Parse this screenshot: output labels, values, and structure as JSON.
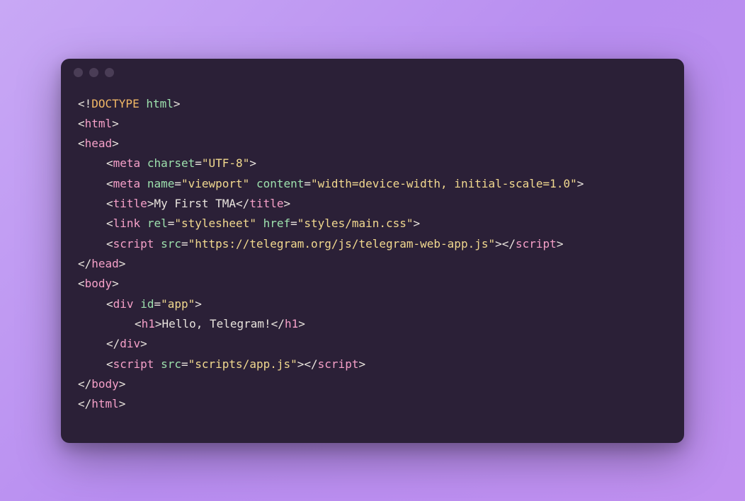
{
  "code": {
    "doctype_open": "<!",
    "doctype_word": "DOCTYPE",
    "doctype_html": "html",
    "doctype_close": ">",
    "lt": "<",
    "gt": ">",
    "lts": "</",
    "eq": "=",
    "tags": {
      "html": "html",
      "head": "head",
      "meta": "meta",
      "title": "title",
      "link": "link",
      "script": "script",
      "body": "body",
      "div": "div",
      "h1": "h1"
    },
    "attrs": {
      "charset": "charset",
      "name": "name",
      "content": "content",
      "rel": "rel",
      "href": "href",
      "src": "src",
      "id": "id"
    },
    "strings": {
      "utf8": "\"UTF-8\"",
      "viewport": "\"viewport\"",
      "viewport_content": "\"width=device-width, initial-scale=1.0\"",
      "stylesheet": "\"stylesheet\"",
      "main_css": "\"styles/main.css\"",
      "telegram_js": "\"https://telegram.org/js/telegram-web-app.js\"",
      "app": "\"app\"",
      "app_js": "\"scripts/app.js\""
    },
    "text": {
      "title_text": "My First TMA",
      "h1_text": "Hello, Telegram!"
    }
  }
}
